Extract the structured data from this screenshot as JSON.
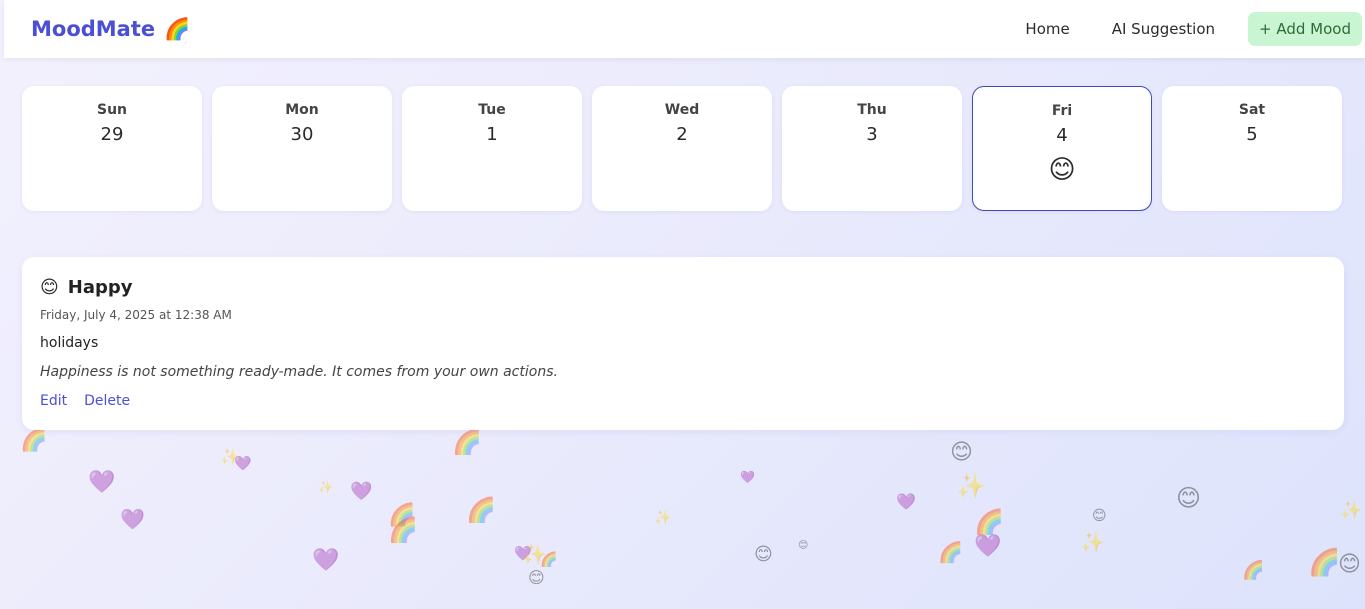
{
  "navbar": {
    "brand": "MoodMate",
    "brand_emoji": "🌈",
    "links": [
      "Home",
      "AI Suggestion"
    ],
    "add_button": "+ Add Mood"
  },
  "week": [
    {
      "day": "Sun",
      "date": "29",
      "emoji": ""
    },
    {
      "day": "Mon",
      "date": "30",
      "emoji": ""
    },
    {
      "day": "Tue",
      "date": "1",
      "emoji": ""
    },
    {
      "day": "Wed",
      "date": "2",
      "emoji": ""
    },
    {
      "day": "Thu",
      "date": "3",
      "emoji": ""
    },
    {
      "day": "Fri",
      "date": "4",
      "emoji": "😊"
    },
    {
      "day": "Sat",
      "date": "5",
      "emoji": ""
    }
  ],
  "entry": {
    "emoji": "😊",
    "mood": "Happy",
    "timestamp": "Friday, July 4, 2025 at 12:38 AM",
    "note": "holidays",
    "quote": "Happiness is not something ready-made. It comes from your own actions.",
    "edit_label": "Edit",
    "delete_label": "Delete"
  },
  "decorations": [
    "🌈",
    "💜",
    "✨",
    "😊"
  ],
  "colors": {
    "accent": "#4a4fd4",
    "add_button_bg": "#c9f5d2",
    "selected_border": "#3f4bb8"
  }
}
